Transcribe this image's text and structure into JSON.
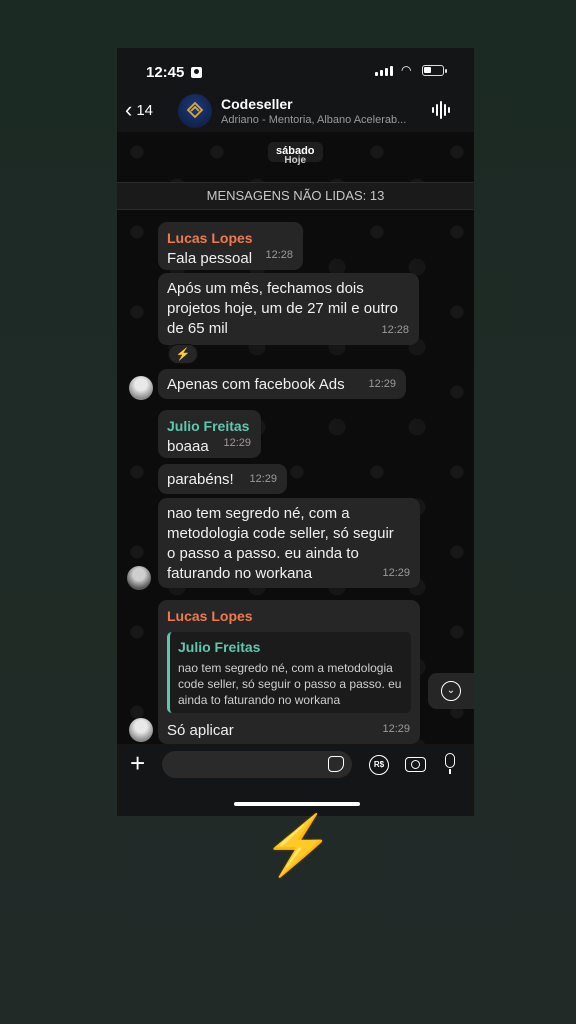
{
  "status": {
    "time": "12:45"
  },
  "header": {
    "back_count": "14",
    "group_name": "Codeseller",
    "group_members": "Adriano - Mentoria, Albano Acelerab..."
  },
  "chat": {
    "date_label": "sábado",
    "date_label_behind": "Hoje",
    "unread_banner": "MENSAGENS NÃO LIDAS: 13",
    "messages": [
      {
        "sender": "Lucas Lopes",
        "text": "Fala pessoal",
        "time": "12:28"
      },
      {
        "text": "Após um mês, fechamos dois projetos hoje, um de 27 mil e outro de 65 mil",
        "time": "12:28",
        "reaction": "⚡"
      },
      {
        "text": "Apenas com facebook Ads",
        "time": "12:29"
      },
      {
        "sender": "Julio Freitas",
        "text": "boaaa",
        "time": "12:29"
      },
      {
        "text": "parabéns!",
        "time": "12:29"
      },
      {
        "text": "nao tem segredo né, com a metodologia code seller, só seguir o passo a passo. eu ainda to faturando no workana",
        "time": "12:29"
      },
      {
        "sender": "Lucas Lopes",
        "quote_sender": "Julio Freitas",
        "quote_text": "nao tem segredo né, com a metodologia code seller, só seguir o passo a passo. eu ainda to faturando no workana",
        "text": "Só aplicar",
        "time": "12:29"
      }
    ]
  },
  "composer": {
    "input_value": ""
  },
  "decoration": {
    "bolt": "⚡"
  },
  "colors": {
    "sender_orange": "#f07a4c",
    "sender_teal": "#5cc8b0",
    "bubble": "#262626"
  }
}
